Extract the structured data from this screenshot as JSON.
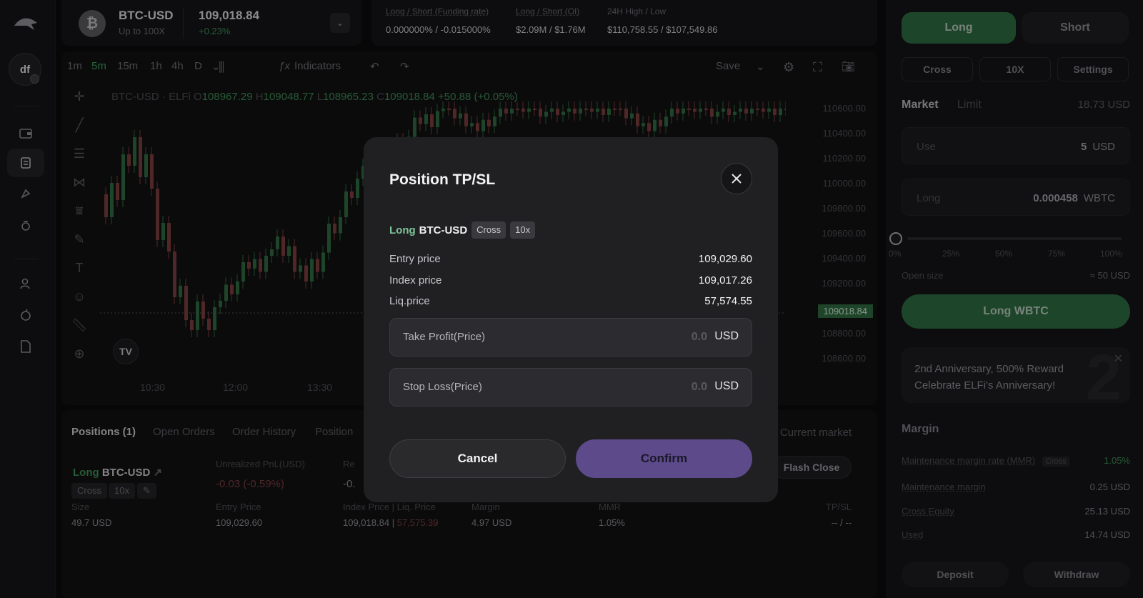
{
  "rail": {
    "avatar": "df"
  },
  "ticker": {
    "pair": "BTC-USD",
    "leverage": "Up to 100X",
    "price": "109,018.84",
    "change": "+0.23%"
  },
  "stats": {
    "funding_label": "Long / Short (Funding rate)",
    "funding_value": "0.000000% / -0.015000%",
    "oi_label": "Long / Short (OI)",
    "oi_value": "$2.09M / $1.76M",
    "hl_label": "24H High / Low",
    "hl_value": "$110,758.55 / $107,549.86"
  },
  "chart_toolbar": {
    "intervals": [
      "1m",
      "5m",
      "15m",
      "1h",
      "4h",
      "D"
    ],
    "active_interval": "5m",
    "indicators": "Indicators",
    "save": "Save"
  },
  "chart_legend": {
    "symbol": "BTC-USD · ELFi",
    "o_label": "O",
    "o": "108967.29",
    "h_label": "H",
    "h": "109048.77",
    "l_label": "L",
    "l": "108965.23",
    "c_label": "C",
    "c": "109018.84",
    "delta": "+50.88 (+0.05%)"
  },
  "chart_data": {
    "type": "candlestick",
    "y_ticks": [
      "110600.00",
      "110400.00",
      "110200.00",
      "110000.00",
      "109800.00",
      "109600.00",
      "109400.00",
      "109200.00",
      "108800.00",
      "108600.00"
    ],
    "x_ticks": [
      "10:30",
      "12:00",
      "13:30"
    ],
    "current_price": "109018.84",
    "colors": {
      "up": "#2f6a3f",
      "down": "#7a3c3c"
    }
  },
  "positions": {
    "tabs": [
      "Positions (1)",
      "Open Orders",
      "Order History",
      "Position"
    ],
    "current_market": "Current market",
    "direction": "Long",
    "pair": "BTC-USD",
    "chips": [
      "Cross",
      "10x"
    ],
    "flash_close": "Flash Close",
    "unrealized_label": "Unrealized PnL(USD)",
    "unrealized_value": "-0.03 (-0.59%)",
    "realized_label": "Re",
    "realized_value": "-0.",
    "size_label": "Size",
    "size_value": "49.7 USD",
    "entry_label": "Entry Price",
    "entry_value": "109,029.60",
    "index_label": "Index Price | Liq. Price",
    "index_value": "109,018.84",
    "liq_value": "57,575.39",
    "margin_label": "Margin",
    "margin_value": "4.97 USD",
    "mmr_label": "MMR",
    "mmr_value": "1.05%",
    "tpsl_label": "TP/SL",
    "tpsl_value": "-- / --"
  },
  "order": {
    "long": "Long",
    "short": "Short",
    "cross": "Cross",
    "leverage": "10X",
    "settings": "Settings",
    "market": "Market",
    "limit": "Limit",
    "available": "18.73 USD",
    "use_label": "Use",
    "use_value": "5",
    "use_unit": "USD",
    "long_label": "Long",
    "long_value": "0.000458",
    "long_unit": "WBTC",
    "pcts": [
      "0%",
      "25%",
      "50%",
      "75%",
      "100%"
    ],
    "open_size_label": "Open size",
    "open_size_value": "≈ 50 USD",
    "submit": "Long WBTC",
    "promo_line1": "2nd Anniversary, 500% Reward",
    "promo_line2": "Celebrate ELFi's Anniversary!",
    "promo_big": "2",
    "margin_title": "Margin",
    "mmr_label": "Maintenance margin rate (MMR)",
    "mmr_chip": "Cross",
    "mmr_value": "1.05%",
    "mm_label": "Maintenance margin",
    "mm_value": "0.25 USD",
    "equity_label": "Cross Equity",
    "equity_value": "25.13 USD",
    "used_label": "Used",
    "used_value": "14.74 USD",
    "deposit": "Deposit",
    "withdraw": "Withdraw"
  },
  "modal": {
    "title": "Position TP/SL",
    "direction": "Long",
    "pair": "BTC-USD",
    "chips": [
      "Cross",
      "10x"
    ],
    "entry_label": "Entry price",
    "entry_value": "109,029.60",
    "index_label": "Index price",
    "index_value": "109,017.26",
    "liq_label": "Liq.price",
    "liq_value": "57,574.55",
    "tp_label": "Take Profit(Price)",
    "tp_placeholder": "0.0",
    "tp_unit": "USD",
    "sl_label": "Stop Loss(Price)",
    "sl_placeholder": "0.0",
    "sl_unit": "USD",
    "cancel": "Cancel",
    "confirm": "Confirm"
  }
}
